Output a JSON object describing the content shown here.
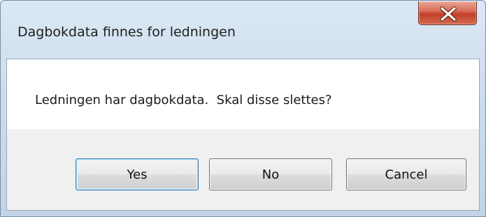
{
  "window": {
    "title": "Dagbokdata finnes for ledningen"
  },
  "dialog": {
    "message": "Ledningen har dagbokdata.  Skal disse slettes?"
  },
  "buttons": {
    "yes_label": "Yes",
    "no_label": "No",
    "cancel_label": "Cancel"
  },
  "icons": {
    "close": "close-icon"
  },
  "colors": {
    "close_button": "#c7432b",
    "title_bar": "#cfdeee",
    "default_button_border": "#3c7fb1"
  }
}
